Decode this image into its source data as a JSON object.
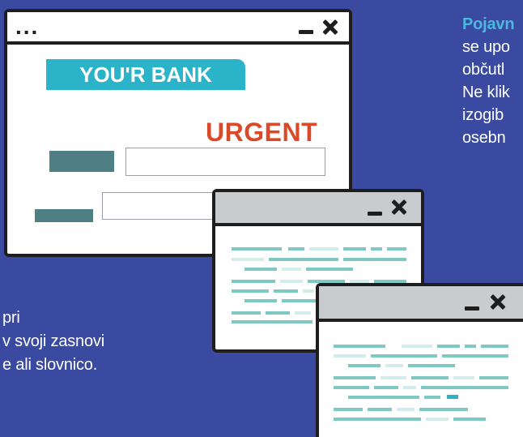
{
  "info_text": {
    "right_lines": [
      {
        "text": "Pojavn",
        "emph": true
      },
      {
        "text": "se upo",
        "emph": false
      },
      {
        "text": "občutl",
        "emph": false
      },
      {
        "text": "Ne klik",
        "emph": false
      },
      {
        "text": "izogib",
        "emph": false
      },
      {
        "text": "osebn",
        "emph": false
      }
    ],
    "left_lines": [
      {
        "text": "pri"
      },
      {
        "text": "v svoji zasnovi"
      },
      {
        "text": "e ali slovnico."
      }
    ]
  },
  "main_window": {
    "dots_label": "...",
    "bank_name": "YOU'R BANK",
    "urgent_label": "URGENT",
    "colors": {
      "badge": "#2bb3c9",
      "urgent": "#d84a2a",
      "button": "#4e7f85",
      "titlebar": "#ffffff"
    }
  },
  "popup_windows": [
    {
      "id": "popup-1",
      "titlebar_color": "#c9cccf",
      "text_line_colors": [
        "#7fc8c4",
        "#d4ecea"
      ]
    },
    {
      "id": "popup-2",
      "titlebar_color": "#c9cccf",
      "text_line_colors": [
        "#7fc8c4",
        "#d4ecea",
        "#2bb3c9"
      ]
    }
  ],
  "palette": {
    "background": "#3a4aa0",
    "frame": "#1e1e1e",
    "info_emphasis": "#4ab8e0",
    "info_text": "#ffffff"
  }
}
